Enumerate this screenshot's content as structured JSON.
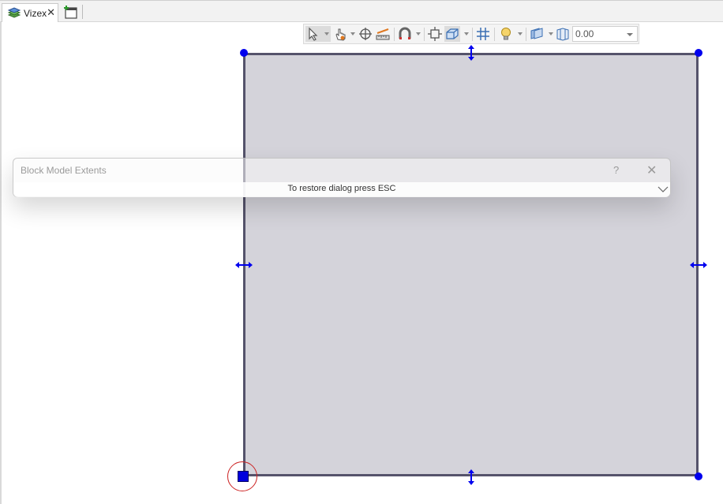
{
  "tabs": [
    {
      "label": "Vizex",
      "close": "✕"
    }
  ],
  "toolbar": {
    "icons": [
      "select-arrow-icon",
      "pan-hand-icon",
      "crosshair-icon",
      "measure-ruler-icon",
      "magnet-snap-icon",
      "zoom-extents-icon",
      "view-box-icon",
      "grid-icon",
      "lightbulb-icon",
      "layers-icon",
      "section-icon"
    ],
    "value": "0.00"
  },
  "dialog": {
    "title": "Block Model Extents",
    "help": "?",
    "close": "✕",
    "hint": "To restore dialog press ESC"
  },
  "colors": {
    "extent_fill": "#d4d3da",
    "extent_border": "#55536b",
    "handle": "#0000ee",
    "highlight": "#cc2222"
  }
}
